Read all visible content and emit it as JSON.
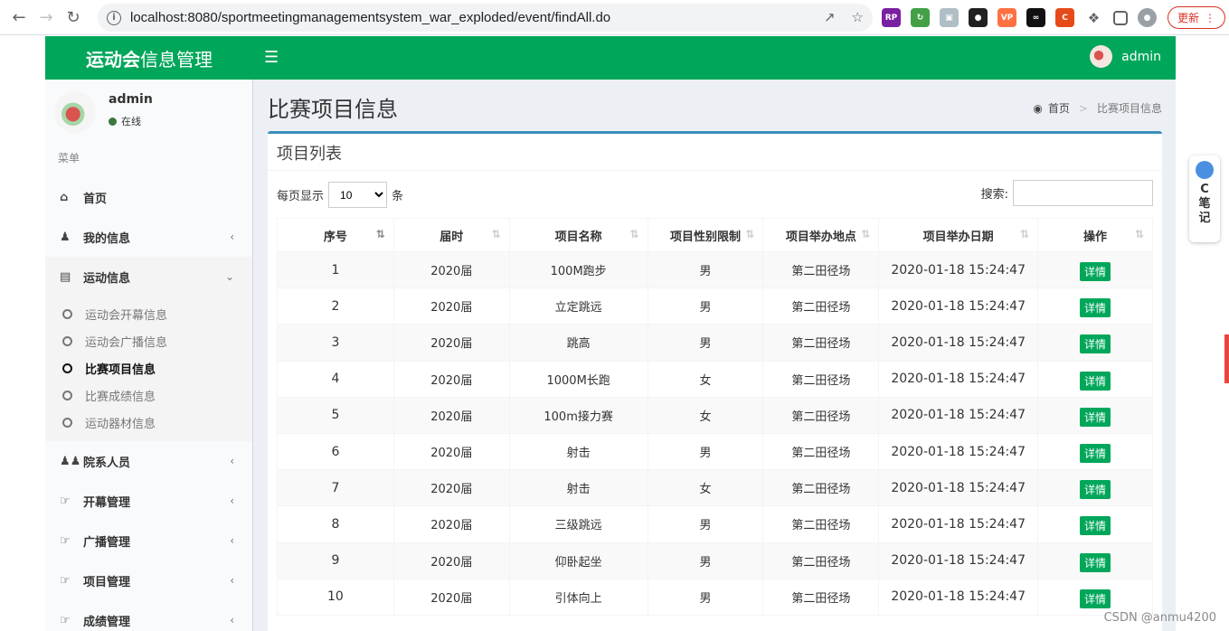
{
  "browser": {
    "url": "localhost:8080/sportmeetingmanagementsystem_war_exploded/event/findAll.do",
    "update_label": "更新"
  },
  "header": {
    "logo_bold": "运动会",
    "logo_rest": "信息管理",
    "user": "admin",
    "brand_color": "#00a65a"
  },
  "sidebar": {
    "user": "admin",
    "status": "在线",
    "menu_header": "菜单",
    "items": [
      {
        "label": "首页",
        "icon": "home-icon"
      },
      {
        "label": "我的信息",
        "icon": "user-icon"
      },
      {
        "label": "运动信息",
        "icon": "bar-chart-icon"
      },
      {
        "label": "院系人员",
        "icon": "users-icon"
      },
      {
        "label": "开幕管理",
        "icon": "hand-point-icon"
      },
      {
        "label": "广播管理",
        "icon": "hand-point-icon"
      },
      {
        "label": "项目管理",
        "icon": "hand-point-icon"
      },
      {
        "label": "成绩管理",
        "icon": "hand-point-icon"
      }
    ],
    "sub_items": [
      "运动会开幕信息",
      "运动会广播信息",
      "比赛项目信息",
      "比赛成绩信息",
      "运动器材信息"
    ]
  },
  "page": {
    "title": "比赛项目信息",
    "breadcrumb_home": "首页",
    "breadcrumb_current": "比赛项目信息"
  },
  "box": {
    "title": "项目列表",
    "per_page_prefix": "每页显示",
    "per_page_value": "10",
    "per_page_suffix": "条",
    "search_label": "搜索:"
  },
  "table": {
    "columns": [
      "序号",
      "届时",
      "项目名称",
      "项目性别限制",
      "项目举办地点",
      "项目举办日期",
      "操作"
    ],
    "action_label": "详情",
    "rows": [
      [
        "1",
        "2020届",
        "100M跑步",
        "男",
        "第二田径场",
        "2020-01-18 15:24:47"
      ],
      [
        "2",
        "2020届",
        "立定跳远",
        "男",
        "第二田径场",
        "2020-01-18 15:24:47"
      ],
      [
        "3",
        "2020届",
        "跳高",
        "男",
        "第二田径场",
        "2020-01-18 15:24:47"
      ],
      [
        "4",
        "2020届",
        "1000M长跑",
        "女",
        "第二田径场",
        "2020-01-18 15:24:47"
      ],
      [
        "5",
        "2020届",
        "100m接力赛",
        "女",
        "第二田径场",
        "2020-01-18 15:24:47"
      ],
      [
        "6",
        "2020届",
        "射击",
        "男",
        "第二田径场",
        "2020-01-18 15:24:47"
      ],
      [
        "7",
        "2020届",
        "射击",
        "女",
        "第二田径场",
        "2020-01-18 15:24:47"
      ],
      [
        "8",
        "2020届",
        "三级跳远",
        "男",
        "第二田径场",
        "2020-01-18 15:24:47"
      ],
      [
        "9",
        "2020届",
        "仰卧起坐",
        "男",
        "第二田径场",
        "2020-01-18 15:24:47"
      ],
      [
        "10",
        "2020届",
        "引体向上",
        "男",
        "第二田径场",
        "2020-01-18 15:24:47"
      ]
    ]
  },
  "csdn": {
    "note_c": "C",
    "note_1": "笔",
    "note_2": "记",
    "watermark": "CSDN @anmu4200"
  }
}
